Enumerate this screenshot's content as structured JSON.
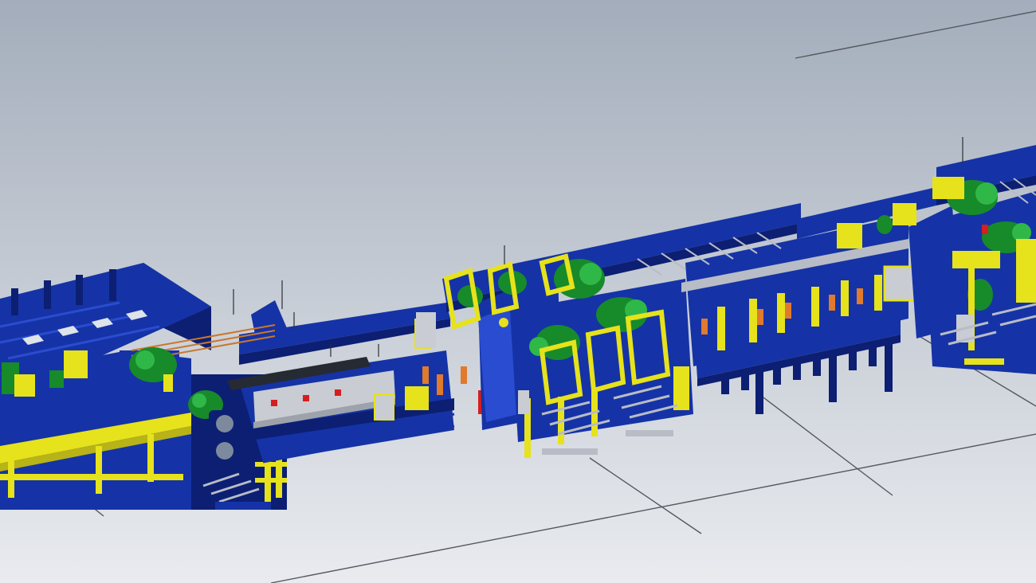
{
  "scene": {
    "subject": "cad-rolling-mill-line-isometric",
    "colors": {
      "background_top": "#a3adbb",
      "background_bottom": "#e9ebef",
      "frame_blue": "#1533a6",
      "frame_blue_dark": "#0c1f73",
      "frame_blue_light": "#2a4cd0",
      "guard_yellow": "#e6e21c",
      "motor_green": "#178a2a",
      "motor_green_light": "#2fb848",
      "actuator_orange": "#e07a2c",
      "accent_red": "#d61e1e",
      "panel_grey": "#c9ccd2",
      "ground_line": "#55585f"
    }
  }
}
